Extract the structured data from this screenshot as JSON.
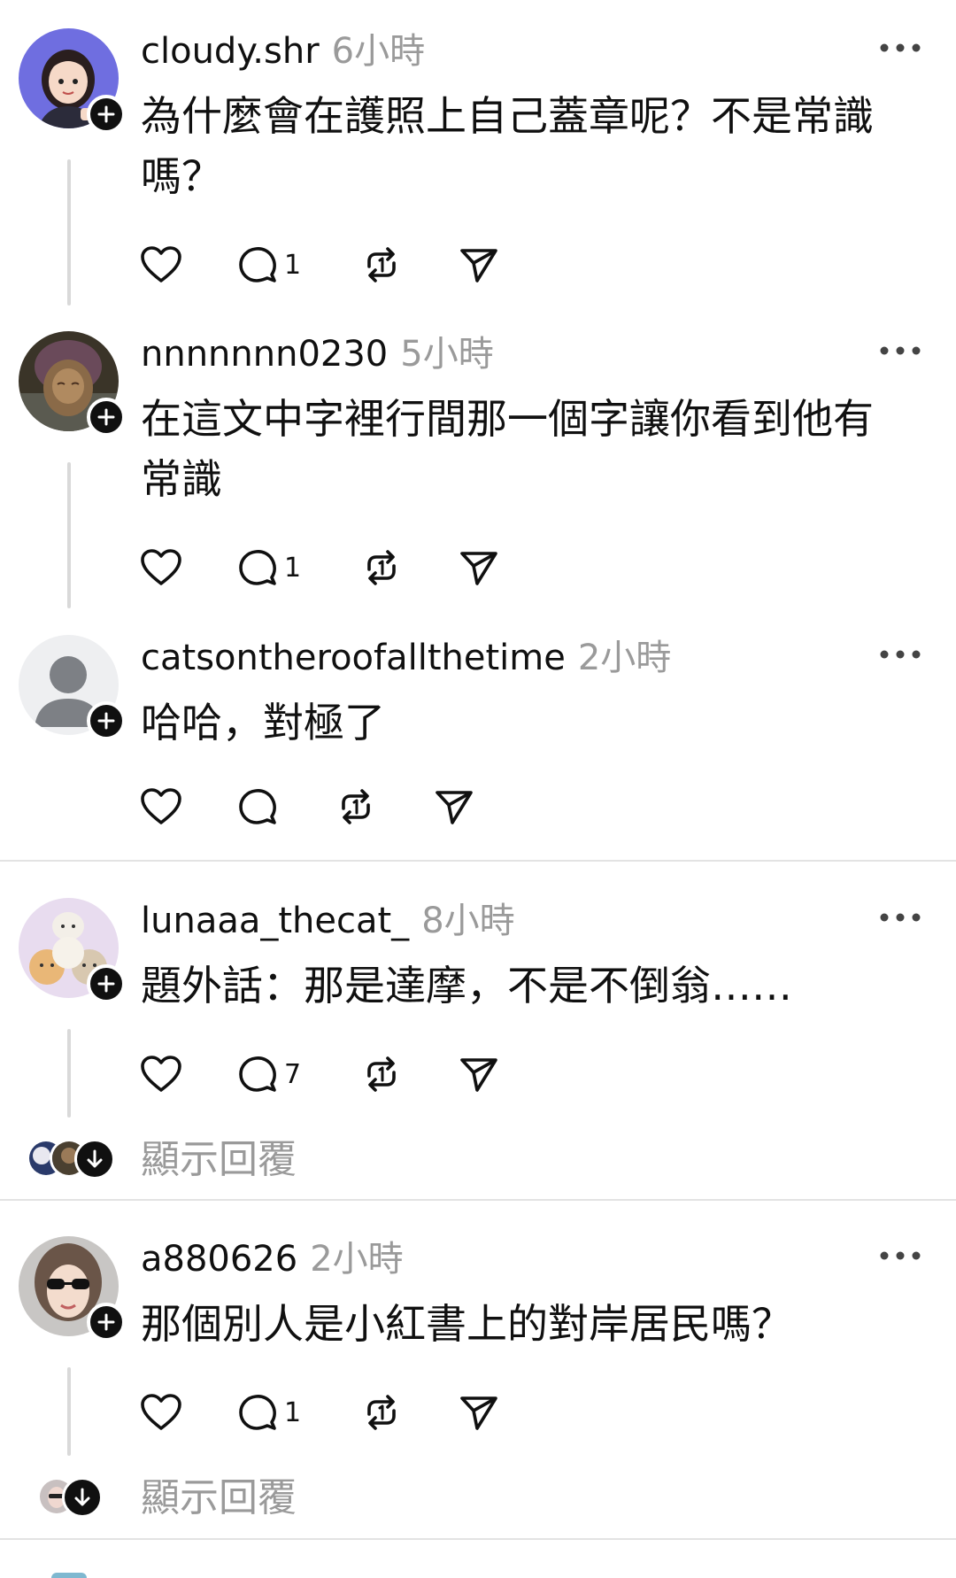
{
  "posts": [
    {
      "username": "cloudy.shr",
      "time": "6小時",
      "text": "為什麼會在護照上自己蓋章呢？不是常識嗎？",
      "reply_count": "1",
      "avatar": "cartoon-girl-avatar"
    },
    {
      "username": "nnnnnnn0230",
      "time": "5小時",
      "text": "在這文中字裡行間那一個字讓你看到他有常識",
      "reply_count": "1",
      "avatar": "statue-avatar"
    },
    {
      "username": "catsontheroofallthetime",
      "time": "2小時",
      "text": "哈哈，對極了",
      "reply_count": "",
      "avatar": "default-person-avatar"
    },
    {
      "username": "lunaaa_thecat_",
      "time": "8小時",
      "text": "題外話：那是達摩，不是不倒翁……",
      "reply_count": "7",
      "avatar": "cats-avatar",
      "show_replies": "顯示回覆"
    },
    {
      "username": "a880626",
      "time": "2小時",
      "text": "那個別人是小紅書上的對岸居民嗎？",
      "reply_count": "1",
      "avatar": "woman-sunglasses-avatar",
      "show_replies": "顯示回覆"
    }
  ],
  "icons": {
    "like": "heart-icon",
    "reply": "comment-icon",
    "repost": "repost-icon",
    "share": "send-icon",
    "more": "more-dots-icon",
    "follow": "plus-icon",
    "expand": "arrow-down-icon"
  },
  "colors": {
    "text": "#101010",
    "muted": "#9a9a9a",
    "divider": "#e3e3e3"
  }
}
